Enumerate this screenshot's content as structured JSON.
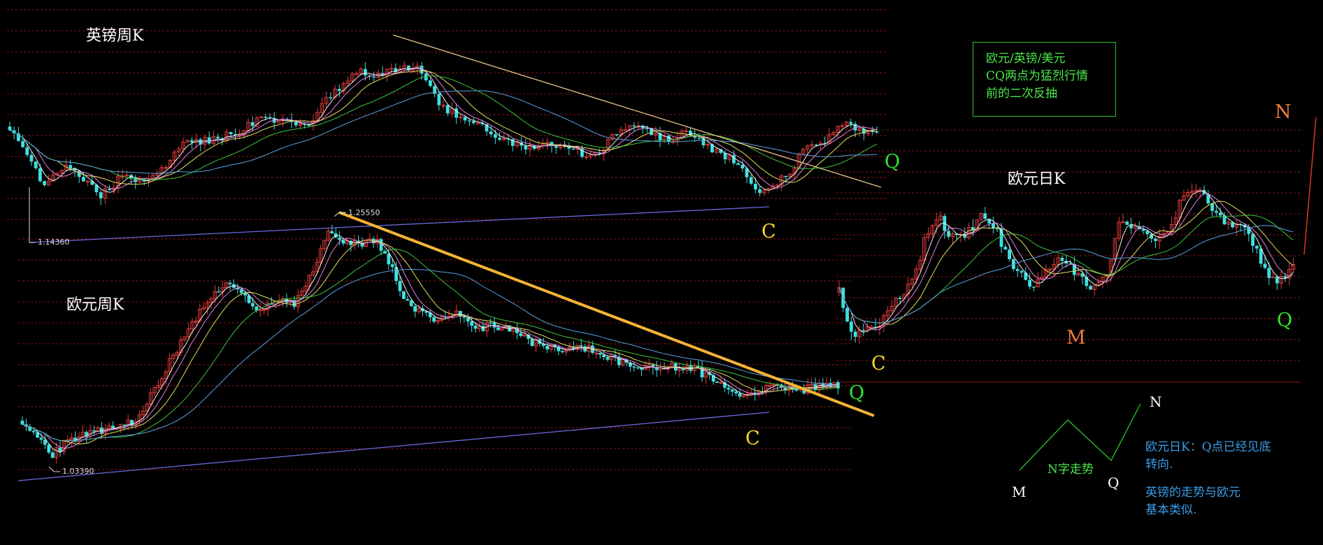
{
  "texts": {
    "gbp_title": "英镑周K",
    "eur_week_title": "欧元周K",
    "eur_day_title": "欧元日K",
    "info_line1": "欧元/英镑/美元",
    "info_line2": "CQ两点为猛烈行情",
    "info_line3": "前的二次反抽",
    "label_c": "C",
    "label_q": "Q",
    "label_m": "M",
    "label_n": "N",
    "pattern_label": "N字走势",
    "note1_line1": "欧元日K：Q点已经见底",
    "note1_line2": "转向.",
    "note2_line1": "英镑的走势与欧元",
    "note2_line2": "基本类似.",
    "gbp_low_price": "1.14360",
    "eur_high_price": "1.25550",
    "eur_low_price": "1.03390"
  },
  "colors": {
    "background": "#000000",
    "up_candle": "#e03a3a",
    "down_candle": "#3fe0e0",
    "grid": "#8a1414",
    "trendline_bold": "#f5b335",
    "trendline_thin": "#e8c48a",
    "support_line": "#6a6ae0",
    "label_c": "#ffd92e",
    "label_q": "#2ee82e",
    "label_m_daily": "#f57a3a",
    "label_n_daily": "#f57a3a",
    "label_mnq_diagram": "#ffffff",
    "diagram_line": "#2ec42e",
    "diagram_text": "#4be84b",
    "note_text": "#3a9de8",
    "info_text": "#4be84b",
    "info_border": "#2ec42e",
    "ma_white": "#f0f0f0",
    "ma_pink": "#e080e0",
    "ma_yellow": "#e0e060",
    "ma_green": "#3ec43e",
    "ma_blue": "#5aa0e0"
  },
  "chart_data": [
    {
      "type": "candlestick",
      "title": "英镑周K",
      "markers": [
        "C",
        "Q"
      ],
      "price_labels": [
        "1.14360"
      ],
      "trendlines": [
        "descending resistance line",
        "ascending support line"
      ],
      "moving_averages": [
        "white",
        "pink",
        "yellow",
        "green",
        "blue"
      ]
    },
    {
      "type": "candlestick",
      "title": "欧元周K",
      "markers": [
        "C",
        "Q"
      ],
      "price_labels": [
        "1.25550",
        "1.03390"
      ],
      "trendlines": [
        "bold descending line from 1.25550 high",
        "ascending support line from 1.03390 low"
      ],
      "moving_averages": [
        "white",
        "pink",
        "yellow",
        "green",
        "blue"
      ]
    },
    {
      "type": "candlestick",
      "title": "欧元日K",
      "markers": [
        "C",
        "M",
        "Q",
        "N"
      ],
      "moving_averages": [
        "white",
        "pink",
        "yellow",
        "green",
        "blue"
      ]
    }
  ]
}
